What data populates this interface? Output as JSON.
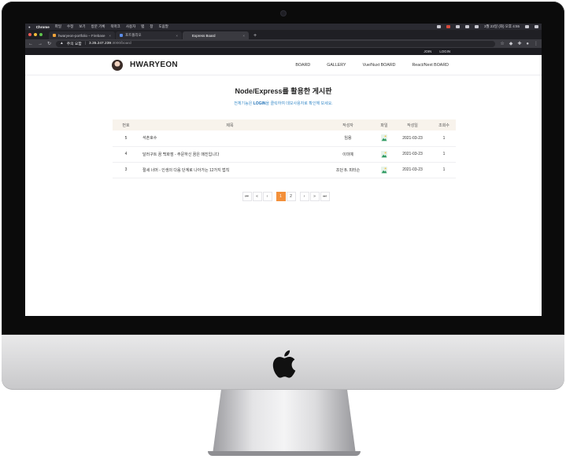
{
  "mac_menubar": {
    "app": "Chrome",
    "menus": [
      "파일",
      "수정",
      "보기",
      "방문 기록",
      "북마크",
      "사용자",
      "탭",
      "창",
      "도움말"
    ],
    "clock": "3월 23일 (화) 오후 4:55"
  },
  "browser": {
    "tabs": [
      {
        "label": "hwaryeon-portfolio – Firebase"
      },
      {
        "label": "포트폴리오"
      },
      {
        "label": "Express Board"
      }
    ],
    "new_tab": "+",
    "address": {
      "security": "주의 요함",
      "host": "3.35.247.239",
      "path": ":3000/board"
    }
  },
  "top_links": {
    "join": "JOIN",
    "login": "LOGIN"
  },
  "site": {
    "logo": "HWARYEON",
    "nav": [
      "BOARD",
      "GALLERY",
      "Vue/Nuxt BOARD",
      "React/Next BOARD"
    ]
  },
  "page": {
    "title": "Node/Express를 활용한 게시판",
    "sub_before": "전체기능은 ",
    "sub_link": "LOGIN",
    "sub_after": "을 클릭하여 데모사용자로 확인해 보세요."
  },
  "table": {
    "headers": {
      "num": "번호",
      "title": "제목",
      "author": "작성자",
      "file": "파일",
      "date": "작성일",
      "views": "조회수"
    },
    "rows": [
      {
        "num": "5",
        "title": "석촌호수",
        "author": "임용",
        "date": "2021-03-23",
        "views": "1"
      },
      {
        "num": "4",
        "title": "달러구트 꿈 백화점 - 주문하신 꿈은 매진입니다",
        "author": "이미예",
        "date": "2021-03-23",
        "views": "1"
      },
      {
        "num": "3",
        "title": "절세 너머 - 인생의 다음 단계로 나아가는 12가지 법칙",
        "author": "조던 B. 피터슨",
        "date": "2021-03-23",
        "views": "1"
      }
    ]
  },
  "pagination": {
    "first": "⏮",
    "prev_group": "«",
    "prev": "‹",
    "pages": [
      "1",
      "2"
    ],
    "current": "1",
    "next": "›",
    "next_group": "»",
    "last": "⏭"
  },
  "colors": {
    "accent": "#f3903a",
    "link": "#3b8cc9",
    "header_bg": "#f8f3ec"
  }
}
